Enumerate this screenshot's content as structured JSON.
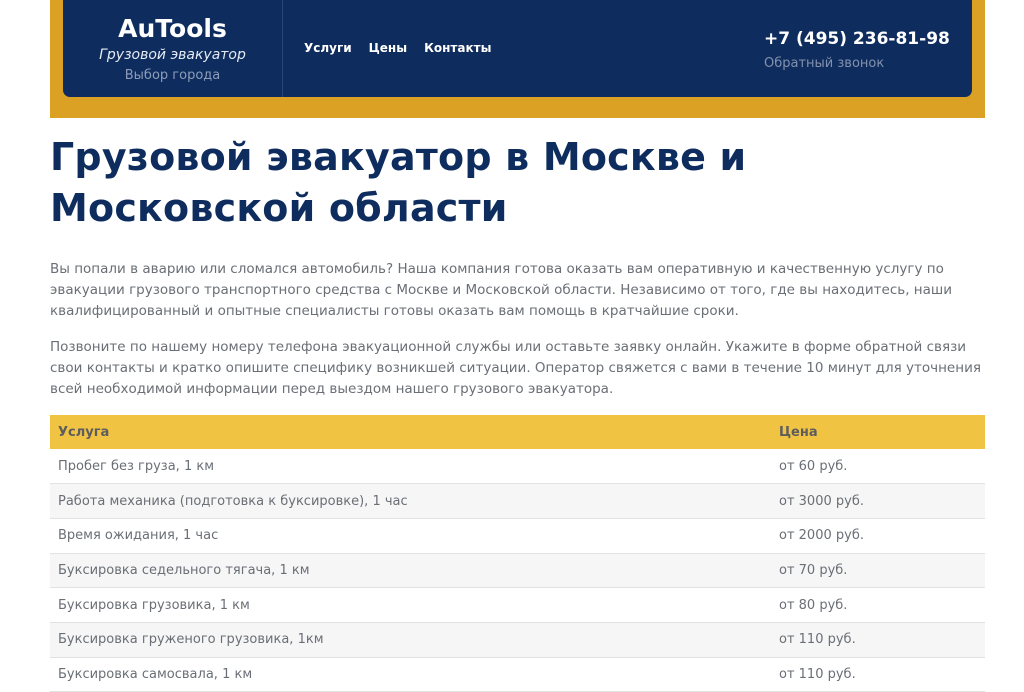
{
  "header": {
    "brand_name": "AuTools",
    "tagline": "Грузовой эвакуатор",
    "city_select": "Выбор города",
    "nav": [
      "Услуги",
      "Цены",
      "Контакты"
    ],
    "phone": "+7 (495) 236-81-98",
    "callback": "Обратный звонок"
  },
  "colors": {
    "header_bg": "#0e2d5e",
    "header_band": "#dba124",
    "table_header_bg": "#f1c343"
  },
  "main": {
    "title": "Грузовой эвакуатор в Москве и Московской области",
    "paragraph_1": "Вы попали в аварию или сломался автомобиль? Наша компания готова оказать вам оперативную и качественную услугу по эвакуации грузового транспортного средства с Москве и Московской области. Независимо от того, где вы находитесь, наши квалифицированный и опытные специалисты готовы оказать вам помощь в кратчайшие сроки.",
    "paragraph_2": "Позвоните по нашему номеру телефона эвакуационной службы или оставьте заявку онлайн. Укажите в форме обратной связи свои контакты и кратко опишите специфику возникшей ситуации. Оператор свяжется с вами в течение 10 минут для уточнения всей необходимой информации перед выездом нашего грузового эвакуатора."
  },
  "price_table": {
    "columns": [
      "Услуга",
      "Цена"
    ],
    "rows": [
      [
        "Пробег без груза, 1 км",
        "от 60 руб."
      ],
      [
        "Работа механика (подготовка к буксировке), 1 час",
        "от 3000 руб."
      ],
      [
        "Время ожидания, 1 час",
        "от 2000 руб."
      ],
      [
        "Буксировка седельного тягача, 1 км",
        "от 70 руб."
      ],
      [
        "Буксировка грузовика, 1 км",
        "от 80 руб."
      ],
      [
        "Буксировка груженого грузовика, 1км",
        "от 110 руб."
      ],
      [
        "Буксировка самосвала, 1 км",
        "от 110 руб."
      ]
    ]
  }
}
